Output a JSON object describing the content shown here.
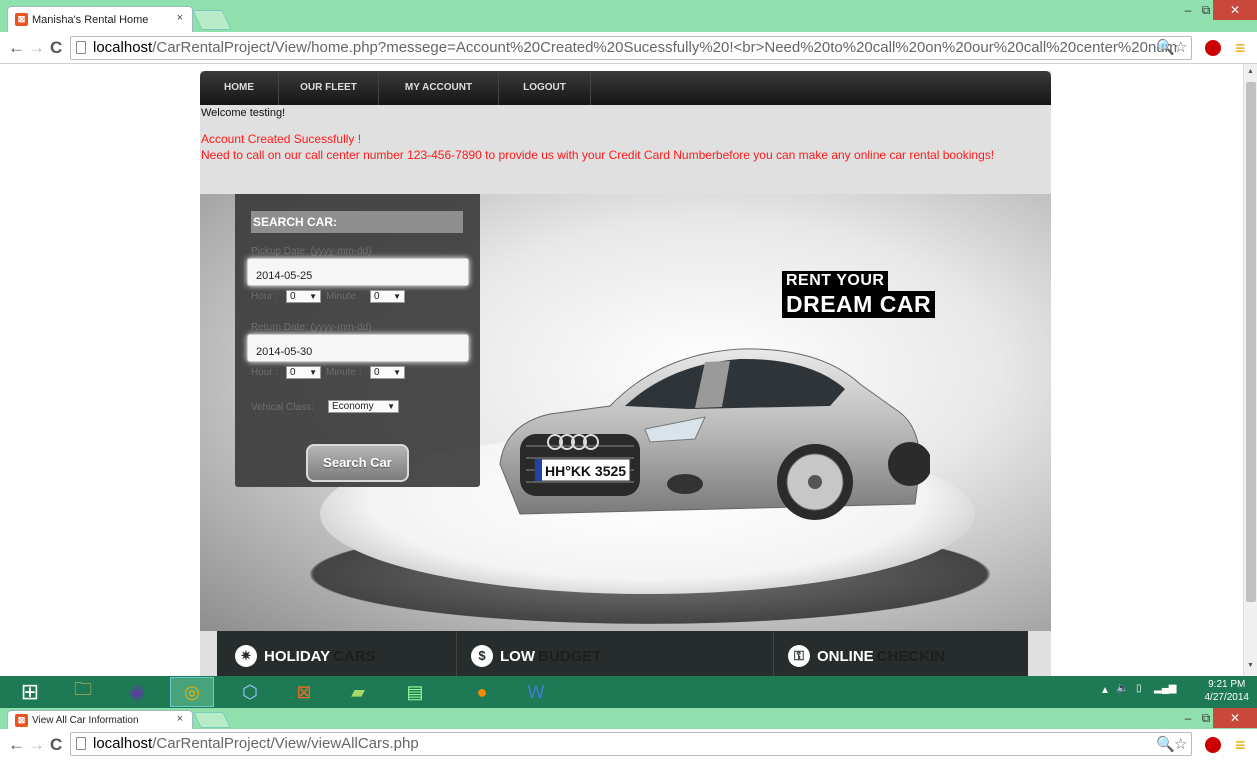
{
  "browser1": {
    "tab_title": "Manisha's Rental Home",
    "tab_close": "×",
    "url_host": "localhost",
    "url_path": "/CarRentalProject/View/home.php?messege=Account%20Created%20Sucessfully%20!<br>Need%20to%20call%20on%20our%20call%20center%20num"
  },
  "nav": {
    "home": "HOME",
    "fleet": "OUR FLEET",
    "account": "MY ACCOUNT",
    "logout": "LOGOUT"
  },
  "welcome": "Welcome testing!",
  "message": {
    "line1": "Account Created Sucessfully !",
    "line2": "Need to call on our call center number 123-456-7890 to provide us with your Credit Card Numberbefore you can make any online car rental bookings!"
  },
  "search": {
    "title": "SEARCH CAR:",
    "pickup_label": "Pickup Date: (yyyy-mm-dd)",
    "pickup_value": "2014-05-25",
    "return_label": "Return Date: (yyyy-mm-dd)",
    "return_value": "2014-05-30",
    "hour_label": "Hour :",
    "minute_label": "Minute :",
    "pickup_hour": "0",
    "pickup_minute": "0",
    "return_hour": "0",
    "return_minute": "0",
    "vehicle_label": "Vehical Class:",
    "vehicle_value": "Economy",
    "button": "Search Car"
  },
  "hero": {
    "line1": "RENT YOUR",
    "line2": "DREAM CAR",
    "plate": "HH°KK 3525"
  },
  "features": [
    {
      "bright": "HOLIDAY",
      "dim": "CARS",
      "icon": "sun-icon"
    },
    {
      "bright": "LOW",
      "dim": "BUDGET",
      "icon": "dollar-icon"
    },
    {
      "bright": "ONLINE",
      "dim": "CHECKIN",
      "icon": "key-icon"
    }
  ],
  "clock": {
    "time": "9:21 PM",
    "date": "4/27/2014"
  },
  "browser2": {
    "tab_title": "View All Car Information",
    "tab_close": "×",
    "url_host": "localhost",
    "url_path": "/CarRentalProject/View/viewAllCars.php"
  },
  "colors": {
    "chrome_frame": "#8fe0ad",
    "taskbar": "#1d7a55",
    "message_red": "#ff1a1a",
    "nav_bg": "#1b1b1b"
  }
}
